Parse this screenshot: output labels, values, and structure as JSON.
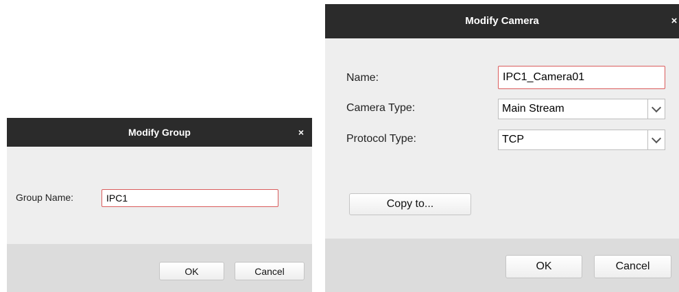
{
  "group_dialog": {
    "title": "Modify Group",
    "close_glyph": "×",
    "group_name_label": "Group Name:",
    "group_name_value": "IPC1",
    "ok_label": "OK",
    "cancel_label": "Cancel"
  },
  "camera_dialog": {
    "title": "Modify Camera",
    "close_glyph": "×",
    "name_label": "Name:",
    "name_value": "IPC1_Camera01",
    "camera_type_label": "Camera Type:",
    "camera_type_value": "Main Stream",
    "protocol_type_label": "Protocol Type:",
    "protocol_type_value": "TCP",
    "copy_to_label": "Copy to...",
    "ok_label": "OK",
    "cancel_label": "Cancel"
  },
  "colors": {
    "titlebar": "#2b2b2b",
    "dialog_body": "#eeeeee",
    "footer": "#dcdcdc",
    "focused_input_border": "#d95a5a"
  },
  "icons": {
    "close": "close-icon",
    "dropdown": "chevron-down-icon"
  }
}
